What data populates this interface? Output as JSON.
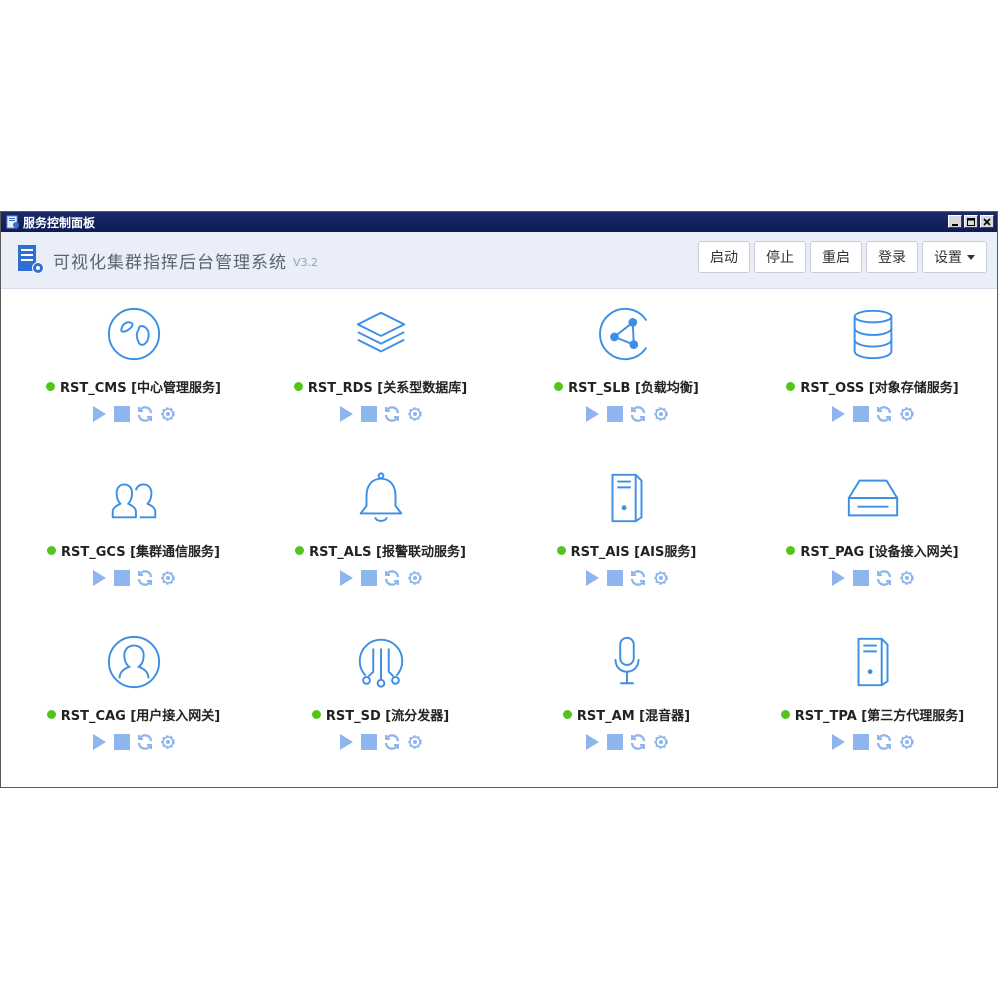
{
  "window": {
    "title": "服务控制面板",
    "controls": [
      "minimize",
      "maximize",
      "close"
    ]
  },
  "header": {
    "title": "可视化集群指挥后台管理系统",
    "version": "V3.2",
    "buttons": {
      "start": "启动",
      "stop": "停止",
      "restart": "重启",
      "login": "登录",
      "settings": "设置"
    }
  },
  "colors": {
    "icon": "#3d8fe6",
    "action": "#8fb5ef",
    "status_running": "#52c41a",
    "titlebar": "#0d1b56"
  },
  "services": [
    {
      "label": "RST_CMS [中心管理服务]",
      "icon": "globe-icon",
      "status": "running"
    },
    {
      "label": "RST_RDS [关系型数据库]",
      "icon": "layers-icon",
      "status": "running"
    },
    {
      "label": "RST_SLB [负载均衡]",
      "icon": "network-triangle-icon",
      "status": "running"
    },
    {
      "label": "RST_OSS [对象存储服务]",
      "icon": "database-icon",
      "status": "running"
    },
    {
      "label": "RST_GCS [集群通信服务]",
      "icon": "users-icon",
      "status": "running"
    },
    {
      "label": "RST_ALS [报警联动服务]",
      "icon": "bell-icon",
      "status": "running"
    },
    {
      "label": "RST_AIS [AIS服务]",
      "icon": "server-tower-icon",
      "status": "running"
    },
    {
      "label": "RST_PAG [设备接入网关]",
      "icon": "storage-tray-icon",
      "status": "running"
    },
    {
      "label": "RST_CAG [用户接入网关]",
      "icon": "user-circle-icon",
      "status": "running"
    },
    {
      "label": "RST_SD [流分发器]",
      "icon": "stream-distributor-icon",
      "status": "running"
    },
    {
      "label": "RST_AM [混音器]",
      "icon": "microphone-icon",
      "status": "running"
    },
    {
      "label": "RST_TPA [第三方代理服务]",
      "icon": "server-tower-icon",
      "status": "running"
    }
  ]
}
